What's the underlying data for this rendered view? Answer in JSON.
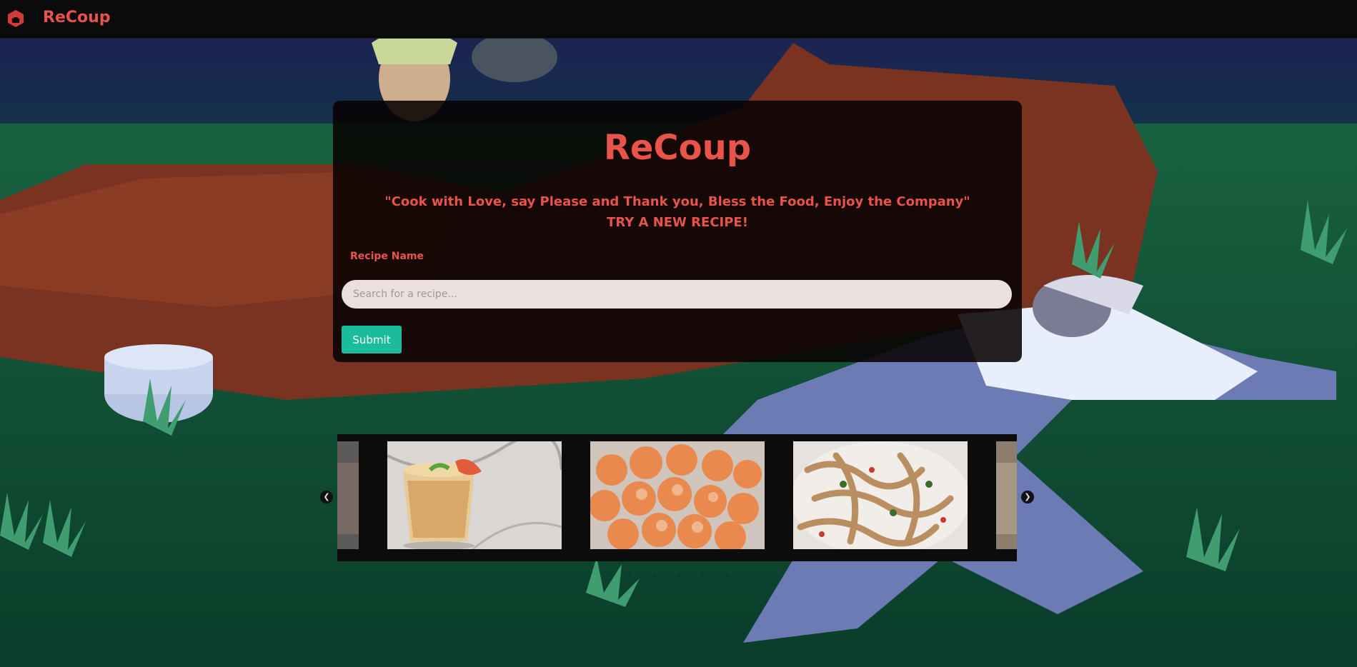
{
  "nav": {
    "brand": "ReCoup",
    "logo_icon": "recoup-logo-icon"
  },
  "hero": {
    "title": "ReCoup",
    "quote": "\"Cook with Love, say Please and Thank you, Bless the Food, Enjoy the Company\"",
    "tagline": "TRY A NEW RECIPE!"
  },
  "form": {
    "label": "Recipe Name",
    "search_placeholder": "Search for a recipe...",
    "search_value": "",
    "submit_label": "Submit"
  },
  "carousel": {
    "slides": [
      "mango-lassi-image",
      "sugar-donuts-image",
      "pasta-image"
    ],
    "prev_icon": "chevron-left-icon",
    "next_icon": "chevron-right-icon",
    "dot_count": 5
  },
  "colors": {
    "accent": "#e8534a",
    "button": "#1abc9c",
    "navbar": "#0b0b0c"
  }
}
